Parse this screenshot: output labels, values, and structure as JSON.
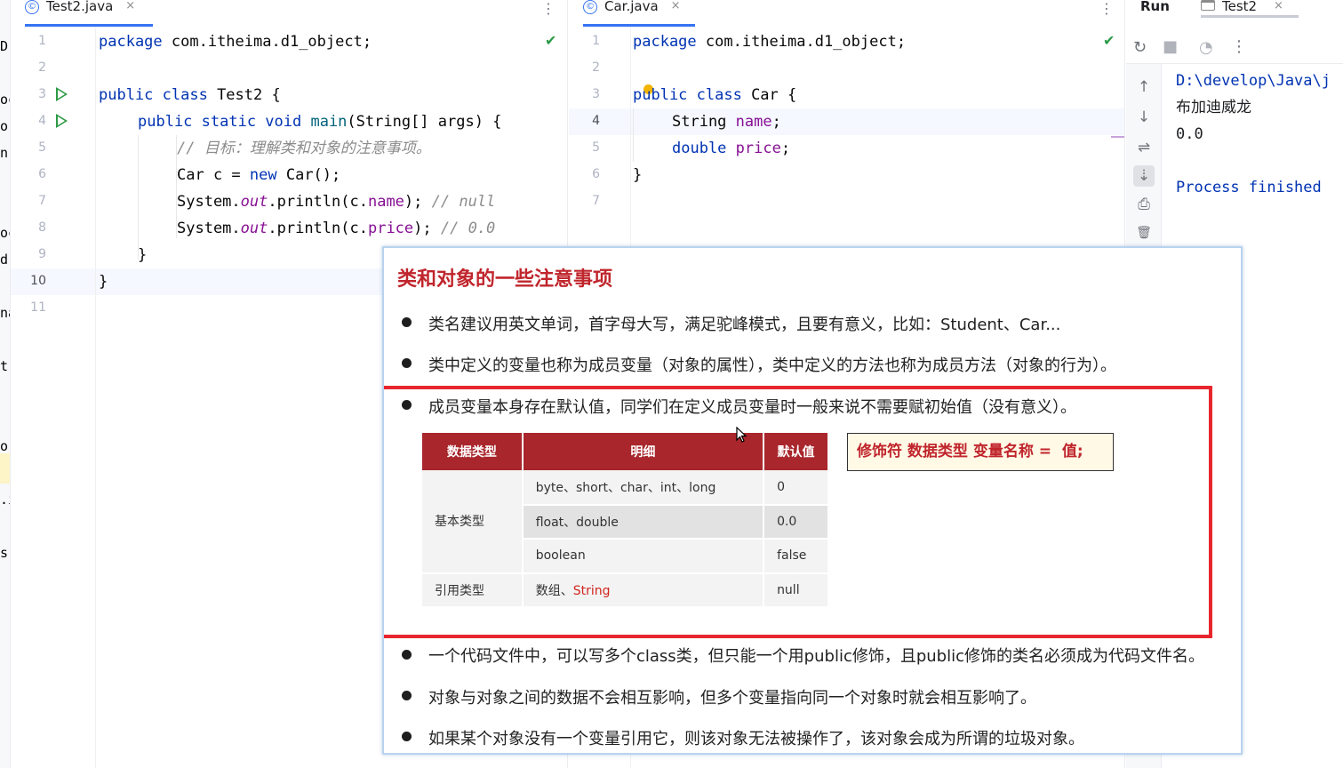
{
  "left_strip_fragments": [
    "D",
    "oc",
    "o",
    "n",
    "oc",
    "d",
    "na",
    "t",
    "o",
    ".i",
    "s"
  ],
  "editor_left": {
    "tab_label": "Test2.java",
    "tab_icon": "©",
    "tab_close": "×",
    "menu": "⋮",
    "line_numbers": [
      "1",
      "2",
      "3",
      "4",
      "5",
      "6",
      "7",
      "8",
      "9",
      "10",
      "11"
    ],
    "current_line": "10",
    "lines": {
      "l1_kw": "package",
      "l1_rest": " com.itheima.d1_object;",
      "l3_kw": "public class",
      "l3_rest": " Test2 {",
      "l4_indent": "    ",
      "l4_kw": "public static void",
      "l4_fn": " main",
      "l4_rest": "(String[] args) {",
      "l5_cmt": "// 目标：理解类和对象的注意事项。",
      "l6_a": "Car c = ",
      "l6_kw": "new",
      "l6_b": " Car();",
      "l7_a": "System.",
      "l7_out": "out",
      "l7_b": ".println(c.",
      "l7_fld": "name",
      "l7_c": "); ",
      "l7_cmt": "// null",
      "l8_a": "System.",
      "l8_out": "out",
      "l8_b": ".println(c.",
      "l8_fld": "price",
      "l8_c": "); ",
      "l8_cmt": "// 0.0",
      "l9": "}",
      "l10": "}"
    }
  },
  "editor_right": {
    "tab_label": "Car.java",
    "tab_icon": "©",
    "tab_close": "×",
    "menu": "⋮",
    "line_numbers": [
      "1",
      "2",
      "3",
      "4",
      "5",
      "6",
      "7"
    ],
    "current_line": "4",
    "lines": {
      "l1_kw": "package",
      "l1_rest": " com.itheima.d1_object;",
      "l3_kw": "public class",
      "l3_rest": " Car {",
      "l4_a": "String ",
      "l4_fld": "name",
      "l4_b": ";",
      "l5_kw": "double",
      "l5_sp": " ",
      "l5_fld": "price",
      "l5_b": ";",
      "l6": "}"
    }
  },
  "run_panel": {
    "title": "Run",
    "tab_label": "Test2",
    "tab_close": "×",
    "toolbar": {
      "rerun": "↻",
      "stop": "■",
      "debug": "◔",
      "more": "⋮"
    },
    "side_buttons": {
      "up": "↑",
      "down": "↓",
      "wrap": "⇌",
      "scroll_end": "⇣",
      "print": "⎙",
      "clear": "🗑"
    },
    "output": [
      "D:\\develop\\Java\\j",
      "布加迪威龙",
      "0.0",
      "",
      "Process finished "
    ]
  },
  "slide": {
    "title": "类和对象的一些注意事项",
    "bullets": [
      "类名建议用英文单词，首字母大写，满足驼峰模式，且要有意义，比如：Student、Car...",
      "类中定义的变量也称为成员变量（对象的属性），类中定义的方法也称为成员方法（对象的行为）。",
      "成员变量本身存在默认值，同学们在定义成员变量时一般来说不需要赋初始值（没有意义）。",
      "一个代码文件中，可以写多个class类，但只能一个用public修饰，且public修饰的类名必须成为代码文件名。",
      "对象与对象之间的数据不会相互影响，但多个变量指向同一个对象时就会相互影响了。",
      "如果某个对象没有一个变量引用它，则该对象无法被操作了，该对象会成为所谓的垃圾对象。"
    ],
    "table": {
      "headers": [
        "数据类型",
        "明细",
        "默认值"
      ],
      "basic_label": "基本类型",
      "ref_label": "引用类型",
      "rows": [
        {
          "detail": "byte、short、char、int、long",
          "default": "0"
        },
        {
          "detail": "float、double",
          "default": "0.0"
        },
        {
          "detail": "boolean",
          "default": "false"
        }
      ],
      "ref_detail_prefix": "数组、",
      "ref_detail_string": "String",
      "ref_default": "null"
    },
    "syntax_hint": "修饰符 数据类型 变量名称 =  值;",
    "accent_red": "#e8262d",
    "table_header_color": "#a8262c"
  }
}
